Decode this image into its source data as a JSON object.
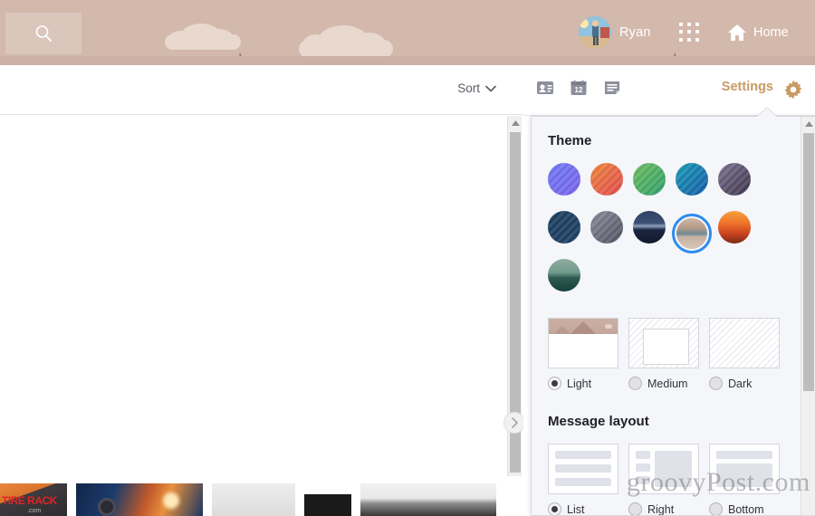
{
  "topbar": {
    "search_icon": "search-icon",
    "user_name": "Ryan",
    "apps_icon": "app-grid-icon",
    "home_icon": "home-icon",
    "home_label": "Home",
    "background_color": "#d3b8ac"
  },
  "toolbar": {
    "sort_label": "Sort",
    "sort_chevron_icon": "chevron-down-icon"
  },
  "panel_header": {
    "icons": [
      {
        "name": "contacts-icon",
        "label": "Contacts"
      },
      {
        "name": "calendar-icon",
        "label": "Calendar",
        "day": "12"
      },
      {
        "name": "tasks-icon",
        "label": "Tasks"
      }
    ],
    "settings_label": "Settings",
    "settings_color": "#c99a63",
    "gear_icon": "gear-icon"
  },
  "settings_panel": {
    "theme": {
      "title": "Theme",
      "selected_index": 8,
      "swatches": [
        {
          "name": "theme-blue-violet",
          "kind": "gradient",
          "from": "#6f7bf7",
          "to": "#7a63e8"
        },
        {
          "name": "theme-orange-red",
          "kind": "gradient",
          "from": "#f08a3c",
          "to": "#e0484f"
        },
        {
          "name": "theme-green",
          "kind": "gradient",
          "from": "#6fbf5f",
          "to": "#2f9e6e"
        },
        {
          "name": "theme-teal-blue",
          "kind": "gradient",
          "from": "#1c9fb5",
          "to": "#1458a8"
        },
        {
          "name": "theme-purple-gray",
          "kind": "gradient",
          "from": "#7e7496",
          "to": "#3b3348"
        },
        {
          "name": "theme-navy-solid",
          "kind": "solid",
          "from": "#1d4061",
          "to": "#1d4061"
        },
        {
          "name": "theme-gray",
          "kind": "gradient",
          "from": "#7c7f8e",
          "to": "#4e505e"
        },
        {
          "name": "theme-night-mountains",
          "kind": "photo",
          "from": "#2b3a5c",
          "to": "#121a2e"
        },
        {
          "name": "theme-desert-lake",
          "kind": "photo",
          "from": "#c9b3a4",
          "to": "#8a9aa0"
        },
        {
          "name": "theme-orange-sunset",
          "kind": "photo",
          "from": "#f07a2a",
          "to": "#b43c1e"
        },
        {
          "name": "theme-teal-mountain",
          "kind": "photo",
          "from": "#7fa89a",
          "to": "#14403c"
        }
      ]
    },
    "density": {
      "options": [
        {
          "name": "density-light",
          "label": "Light",
          "selected": true
        },
        {
          "name": "density-medium",
          "label": "Medium",
          "selected": false
        },
        {
          "name": "density-dark",
          "label": "Dark",
          "selected": false
        }
      ]
    },
    "message_layout": {
      "title": "Message layout",
      "options": [
        {
          "name": "layout-list",
          "label": "List",
          "selected": true
        },
        {
          "name": "layout-right",
          "label": "Right",
          "selected": false
        },
        {
          "name": "layout-bottom",
          "label": "Bottom",
          "selected": false
        }
      ]
    }
  },
  "thumbnails": {
    "items": [
      {
        "name": "thumb-tire-rack-ad",
        "brand": "TIRE RACK",
        "sub": ".com"
      },
      {
        "name": "thumb-night-race"
      },
      {
        "name": "thumb-light-gray"
      },
      {
        "name": "thumb-dark-small"
      },
      {
        "name": "thumb-landscape-bw"
      }
    ]
  },
  "scrollbars": {
    "left_up_icon": "scroll-up-arrow-icon",
    "panel_up_icon": "scroll-up-arrow-icon",
    "expand_icon": "chevron-right-icon"
  },
  "watermark": {
    "text": "groovyPost.com"
  }
}
